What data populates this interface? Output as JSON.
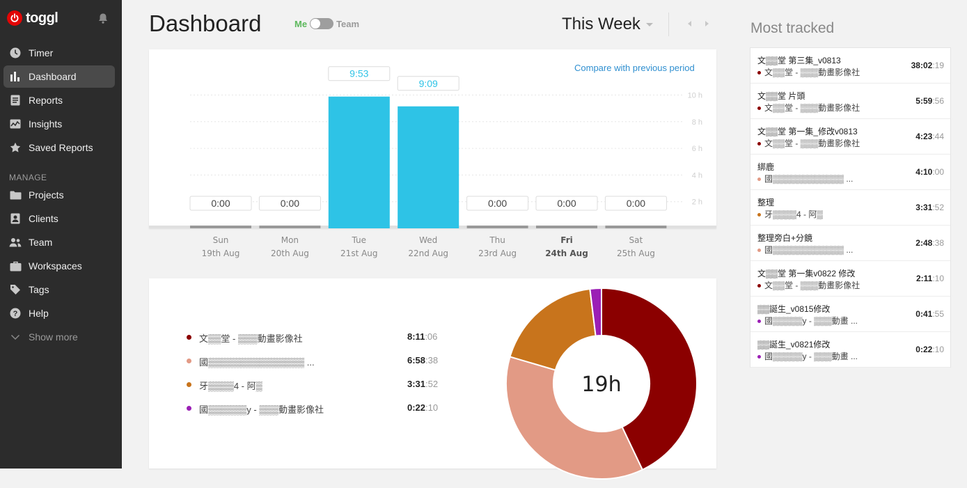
{
  "app": {
    "logo_text": "toggl"
  },
  "sidebar": {
    "items": [
      {
        "label": "Timer",
        "icon": "clock-icon"
      },
      {
        "label": "Dashboard",
        "icon": "bar-chart-icon"
      },
      {
        "label": "Reports",
        "icon": "document-icon"
      },
      {
        "label": "Insights",
        "icon": "line-chart-icon"
      },
      {
        "label": "Saved Reports",
        "icon": "star-icon"
      }
    ],
    "manage_label": "MANAGE",
    "manage_items": [
      {
        "label": "Projects",
        "icon": "folder-icon"
      },
      {
        "label": "Clients",
        "icon": "person-card-icon"
      },
      {
        "label": "Team",
        "icon": "people-icon"
      },
      {
        "label": "Workspaces",
        "icon": "briefcase-icon"
      },
      {
        "label": "Tags",
        "icon": "tag-icon"
      },
      {
        "label": "Help",
        "icon": "question-icon"
      },
      {
        "label": "Show more",
        "icon": "chevron-down-icon"
      }
    ]
  },
  "header": {
    "title": "Dashboard",
    "toggle_me": "Me",
    "toggle_team": "Team",
    "period": "This Week"
  },
  "chart_data": {
    "type": "bar",
    "categories": [
      "Sun",
      "Mon",
      "Tue",
      "Wed",
      "Thu",
      "Fri",
      "Sat"
    ],
    "dates": [
      "19th Aug",
      "20th Aug",
      "21st Aug",
      "22nd Aug",
      "23rd Aug",
      "24th Aug",
      "25th Aug"
    ],
    "values": [
      0,
      0,
      9.883,
      9.15,
      0,
      0,
      0
    ],
    "value_labels": [
      "0:00",
      "0:00",
      "9:53",
      "9:09",
      "0:00",
      "0:00",
      "0:00"
    ],
    "highlight_day": "Fri",
    "y_ticks": [
      "2 h",
      "4 h",
      "6 h",
      "8 h",
      "10 h"
    ],
    "ylim": [
      0,
      10
    ],
    "grid": true,
    "bar_color": "#2ec3e6",
    "compare_link": "Compare with previous period"
  },
  "donut": {
    "center_label": "19h",
    "entries": [
      {
        "label": "文▒▒堂 - ▒▒▒動畫影像社",
        "h": "8:11",
        "s": ":06",
        "hours": 8.185,
        "color": "#8b0000"
      },
      {
        "label": "國▒▒▒▒▒▒▒▒▒▒▒▒▒▒▒ ...",
        "h": "6:58",
        "s": ":38",
        "hours": 6.977,
        "color": "#e29a85"
      },
      {
        "label": "牙▒▒▒▒4 - 阿▒",
        "h": "3:31",
        "s": ":52",
        "hours": 3.531,
        "color": "#c8741c"
      },
      {
        "label": "國▒▒▒▒▒▒y - ▒▒▒動畫影像社",
        "h": "0:22",
        "s": ":10",
        "hours": 0.369,
        "color": "#9b1fb5",
        "prefix": "0"
      }
    ]
  },
  "most_tracked": {
    "title": "Most tracked",
    "items": [
      {
        "name": "文▒▒堂 第三集_v0813",
        "project": "文▒▒堂 - ▒▒▒動畫影像社",
        "h": "38:02",
        "s": ":19",
        "color": "#8b0000"
      },
      {
        "name": "文▒▒堂 片頭",
        "project": "文▒▒堂 - ▒▒▒動畫影像社",
        "h": "5:59",
        "s": ":56",
        "color": "#8b0000"
      },
      {
        "name": "文▒▒堂 第一集_修改v0813",
        "project": "文▒▒堂 - ▒▒▒動畫影像社",
        "h": "4:23",
        "s": ":44",
        "color": "#8b0000"
      },
      {
        "name": "綁鹿",
        "project": "國▒▒▒▒▒▒▒▒▒▒▒▒ ...",
        "h": "4:10",
        "s": ":00",
        "color": "#e29a85"
      },
      {
        "name": "整理",
        "project": "牙▒▒▒▒4 - 阿▒",
        "h": "3:31",
        "s": ":52",
        "color": "#c8741c"
      },
      {
        "name": "整理旁白+分鏡",
        "project": "國▒▒▒▒▒▒▒▒▒▒▒▒ ...",
        "h": "2:48",
        "s": ":38",
        "color": "#e29a85"
      },
      {
        "name": "文▒▒堂 第一集v0822 修改",
        "project": "文▒▒堂 - ▒▒▒動畫影像社",
        "h": "2:11",
        "s": ":10",
        "color": "#8b0000"
      },
      {
        "name": "▒▒誕生_v0815修改",
        "project": "國▒▒▒▒▒y - ▒▒▒動畫 ...",
        "h": "0:41",
        "s": ":55",
        "color": "#9b1fb5"
      },
      {
        "name": "▒▒誕生_v0821修改",
        "project": "國▒▒▒▒▒y - ▒▒▒動畫 ...",
        "h": "0:22",
        "s": ":10",
        "color": "#9b1fb5"
      }
    ]
  }
}
